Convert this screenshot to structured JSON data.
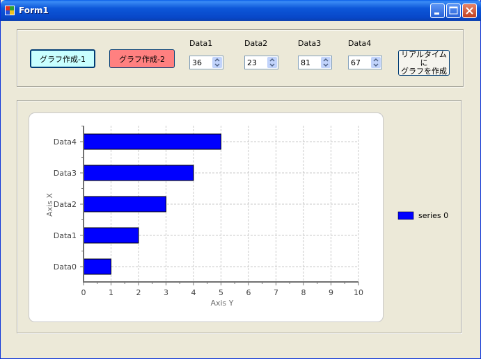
{
  "window": {
    "title": "Form1"
  },
  "buttons": {
    "create_graph_1": "グラフ作成-1",
    "create_graph_2": "グラフ作成-2",
    "realtime_line1": "リアルタイムに",
    "realtime_line2": "グラフを作成"
  },
  "inputs": [
    {
      "label": "Data1",
      "value": "36"
    },
    {
      "label": "Data2",
      "value": "23"
    },
    {
      "label": "Data3",
      "value": "81"
    },
    {
      "label": "Data4",
      "value": "67"
    }
  ],
  "colors": {
    "series": "#0000ff",
    "button2_bg": "#ff8080",
    "button1_bg": "#c8ffff"
  },
  "chart_data": {
    "type": "bar",
    "orientation": "horizontal",
    "categories": [
      "Data0",
      "Data1",
      "Data2",
      "Data3",
      "Data4"
    ],
    "series": [
      {
        "name": "series 0",
        "values": [
          1,
          2,
          3,
          4,
          5
        ]
      }
    ],
    "xlabel": "Axis Y",
    "ylabel": "Axis X",
    "xlim": [
      0,
      10
    ],
    "xticks": [
      "0",
      "1",
      "2",
      "3",
      "4",
      "5",
      "6",
      "7",
      "8",
      "9",
      "10"
    ],
    "grid": true,
    "legend": "right"
  }
}
